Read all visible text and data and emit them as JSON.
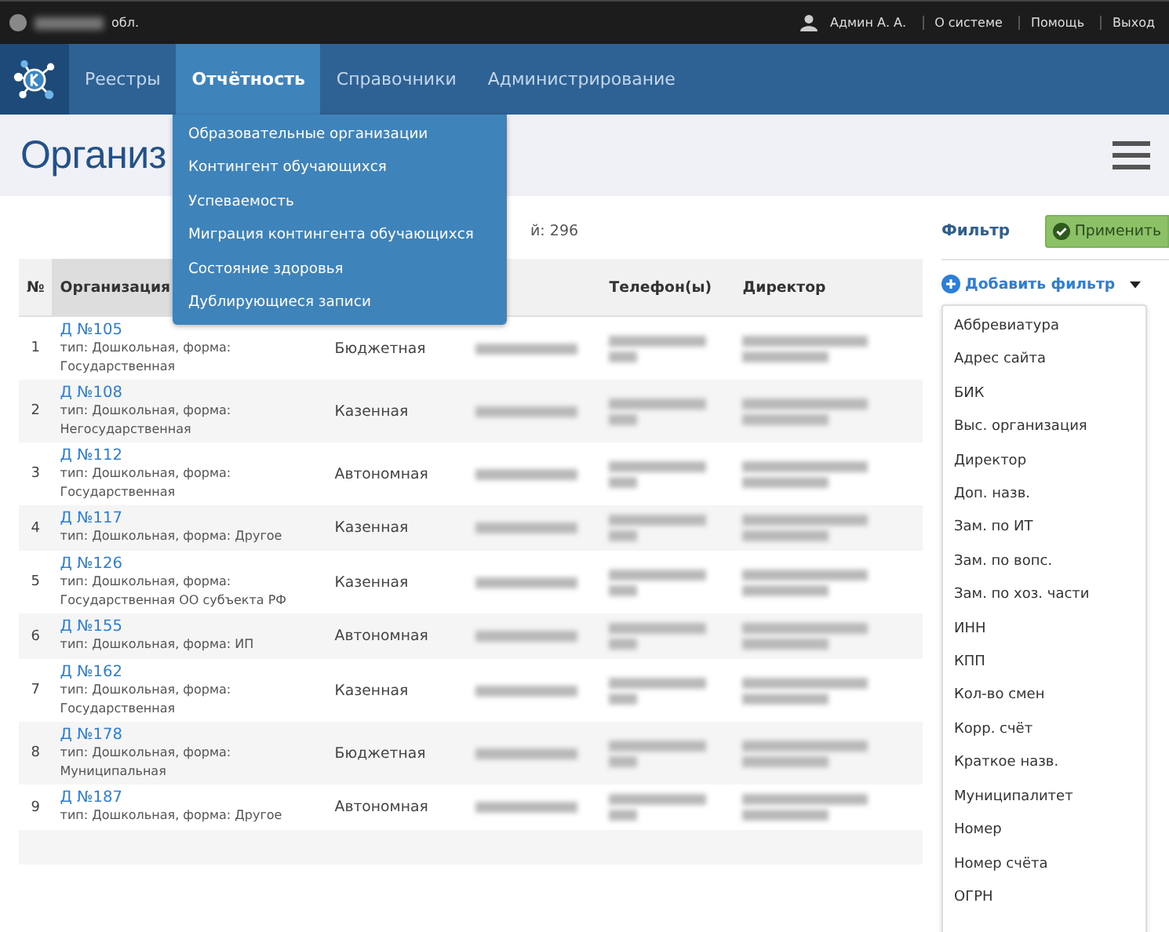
{
  "top_bar": {
    "region": "обл.",
    "user": "Админ А. А.",
    "links": [
      "О системе",
      "Помощь",
      "Выход"
    ]
  },
  "nav": {
    "tabs": [
      {
        "label": "Реестры",
        "selected": false
      },
      {
        "label": "Отчётность",
        "selected": true
      },
      {
        "label": "Справочники",
        "selected": false
      },
      {
        "label": "Администрирование",
        "selected": false
      }
    ],
    "menu": [
      "Образовательные организации",
      "Контингент обучающихся",
      "Успеваемость",
      "Миграция контингента обучающихся",
      "Состояние здоровья",
      "Дублирующиеся записи"
    ]
  },
  "page_title": "Организ",
  "count": "й: 296",
  "table": {
    "columns": [
      "№",
      "Организация"
    ],
    "columns_right": [
      "Телефон(ы)",
      "Директор"
    ],
    "rows": [
      {
        "num": "1",
        "name": "Д №105",
        "desc": "тип: Дошкольная, форма: Государственная",
        "form": "Бюджетная"
      },
      {
        "num": "2",
        "name": "Д №108",
        "desc": "тип: Дошкольная, форма: Негосударственная",
        "form": "Казенная"
      },
      {
        "num": "3",
        "name": "Д №112",
        "desc": "тип: Дошкольная, форма: Государственная",
        "form": "Автономная"
      },
      {
        "num": "4",
        "name": "Д №117",
        "desc": "тип: Дошкольная, форма: Другое",
        "form": "Казенная"
      },
      {
        "num": "5",
        "name": "Д №126",
        "desc": "тип: Дошкольная, форма: Государственная ОО субъекта РФ",
        "form": "Казенная"
      },
      {
        "num": "6",
        "name": "Д №155",
        "desc": "тип: Дошкольная, форма: ИП",
        "form": "Автономная"
      },
      {
        "num": "7",
        "name": "Д №162",
        "desc": "тип: Дошкольная, форма: Государственная",
        "form": "Казенная"
      },
      {
        "num": "8",
        "name": "Д №178",
        "desc": "тип: Дошкольная, форма: Муниципальная",
        "form": "Бюджетная"
      },
      {
        "num": "9",
        "name": "Д №187",
        "desc": "тип: Дошкольная, форма: Другое",
        "form": "Автономная"
      }
    ]
  },
  "filter": {
    "title": "Фильтр",
    "apply": "Применить",
    "add": "Добавить фильтр",
    "options": [
      "Аббревиатура",
      "Адрес сайта",
      "БИК",
      "Выс. организация",
      "Директор",
      "Доп. назв.",
      "Зам. по ИТ",
      "Зам. по вопс.",
      "Зам. по хоз. части",
      "ИНН",
      "КПП",
      "Кол-во смен",
      "Корр. счёт",
      "Краткое назв.",
      "Муниципалитет",
      "Номер",
      "Номер счёта",
      "ОГРН"
    ]
  }
}
